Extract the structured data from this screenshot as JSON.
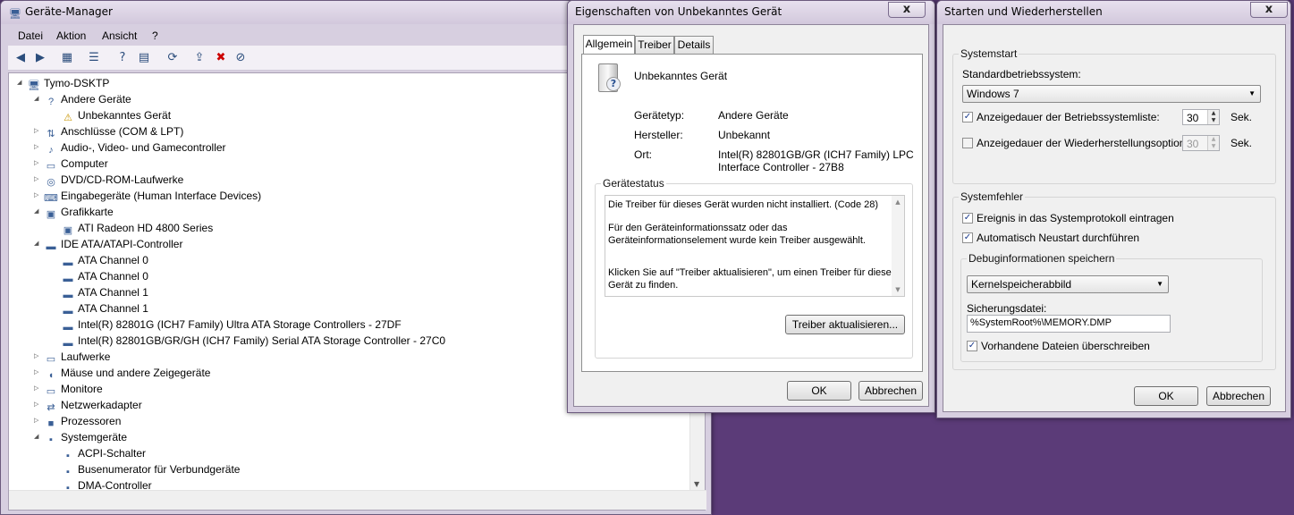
{
  "devmgr": {
    "title": "Geräte-Manager",
    "menu": [
      "Datei",
      "Aktion",
      "Ansicht",
      "?"
    ],
    "tree": [
      {
        "label": "Tymo-DSKTP",
        "level": 0,
        "exp": "open",
        "icon": "computer-icon"
      },
      {
        "label": "Andere Geräte",
        "level": 1,
        "exp": "open",
        "icon": "unknown-device-icon"
      },
      {
        "label": "Unbekanntes Gerät",
        "level": 2,
        "exp": "",
        "icon": "warning-device-icon"
      },
      {
        "label": "Anschlüsse (COM & LPT)",
        "level": 1,
        "exp": "closed",
        "icon": "port-icon"
      },
      {
        "label": "Audio-, Video- und Gamecontroller",
        "level": 1,
        "exp": "closed",
        "icon": "speaker-icon"
      },
      {
        "label": "Computer",
        "level": 1,
        "exp": "closed",
        "icon": "monitor-icon"
      },
      {
        "label": "DVD/CD-ROM-Laufwerke",
        "level": 1,
        "exp": "closed",
        "icon": "disc-drive-icon"
      },
      {
        "label": "Eingabegeräte (Human Interface Devices)",
        "level": 1,
        "exp": "closed",
        "icon": "hid-icon"
      },
      {
        "label": "Grafikkarte",
        "level": 1,
        "exp": "open",
        "icon": "display-adapter-icon"
      },
      {
        "label": "ATI Radeon HD 4800 Series",
        "level": 2,
        "exp": "",
        "icon": "display-adapter-icon"
      },
      {
        "label": "IDE ATA/ATAPI-Controller",
        "level": 1,
        "exp": "open",
        "icon": "ide-controller-icon"
      },
      {
        "label": "ATA Channel 0",
        "level": 2,
        "exp": "",
        "icon": "ide-controller-icon"
      },
      {
        "label": "ATA Channel 0",
        "level": 2,
        "exp": "",
        "icon": "ide-controller-icon"
      },
      {
        "label": "ATA Channel 1",
        "level": 2,
        "exp": "",
        "icon": "ide-controller-icon"
      },
      {
        "label": "ATA Channel 1",
        "level": 2,
        "exp": "",
        "icon": "ide-controller-icon"
      },
      {
        "label": "Intel(R) 82801G (ICH7 Family) Ultra ATA Storage Controllers - 27DF",
        "level": 2,
        "exp": "",
        "icon": "ide-controller-icon"
      },
      {
        "label": "Intel(R) 82801GB/GR/GH (ICH7 Family) Serial ATA Storage Controller - 27C0",
        "level": 2,
        "exp": "",
        "icon": "ide-controller-icon"
      },
      {
        "label": "Laufwerke",
        "level": 1,
        "exp": "closed",
        "icon": "disk-drive-icon"
      },
      {
        "label": "Mäuse und andere Zeigegeräte",
        "level": 1,
        "exp": "closed",
        "icon": "mouse-icon"
      },
      {
        "label": "Monitore",
        "level": 1,
        "exp": "closed",
        "icon": "monitor-icon"
      },
      {
        "label": "Netzwerkadapter",
        "level": 1,
        "exp": "closed",
        "icon": "network-adapter-icon"
      },
      {
        "label": "Prozessoren",
        "level": 1,
        "exp": "closed",
        "icon": "processor-icon"
      },
      {
        "label": "Systemgeräte",
        "level": 1,
        "exp": "open",
        "icon": "system-device-icon"
      },
      {
        "label": "ACPI-Schalter",
        "level": 2,
        "exp": "",
        "icon": "system-device-icon"
      },
      {
        "label": "Busenumerator für Verbundgeräte",
        "level": 2,
        "exp": "",
        "icon": "system-device-icon"
      },
      {
        "label": "DMA-Controller",
        "level": 2,
        "exp": "",
        "icon": "system-device-icon"
      }
    ]
  },
  "props": {
    "title": "Eigenschaften von Unbekanntes Gerät",
    "tabs": [
      "Allgemein",
      "Treiber",
      "Details"
    ],
    "device_name": "Unbekanntes Gerät",
    "type_label": "Gerätetyp:",
    "type_value": "Andere Geräte",
    "mfr_label": "Hersteller:",
    "mfr_value": "Unbekannt",
    "loc_label": "Ort:",
    "loc_value_1": "Intel(R) 82801GB/GR (ICH7 Family) LPC",
    "loc_value_2": "Interface Controller - 27B8",
    "status_group": "Gerätestatus",
    "status_1": "Die Treiber für dieses Gerät wurden nicht installiert. (Code 28)",
    "status_2": "Für den Geräteinformationssatz oder das",
    "status_3": "Geräteinformationselement wurde kein Treiber ausgewählt.",
    "status_4": "Klicken Sie auf \"Treiber aktualisieren\", um einen Treiber für dieses",
    "status_5": "Gerät zu finden.",
    "update_btn": "Treiber aktualisieren...",
    "ok": "OK",
    "cancel": "Abbrechen"
  },
  "startup": {
    "title": "Starten und Wiederherstellen",
    "g1": "Systemstart",
    "default_os_label": "Standardbetriebssystem:",
    "default_os": "Windows 7",
    "show_list": "Anzeigedauer der Betriebssystemliste:",
    "show_list_val": "30",
    "show_recovery": "Anzeigedauer der Wiederherstellungsoptionen:",
    "show_recovery_val": "30",
    "sek": "Sek.",
    "g2": "Systemfehler",
    "log_event": "Ereignis in das Systemprotokoll eintragen",
    "auto_restart": "Automatisch Neustart durchführen",
    "g3": "Debuginformationen speichern",
    "debug_type": "Kernelspeicherabbild",
    "dump_label": "Sicherungsdatei:",
    "dump_path": "%SystemRoot%\\MEMORY.DMP",
    "overwrite": "Vorhandene Dateien überschreiben",
    "ok": "OK",
    "cancel": "Abbrechen"
  }
}
